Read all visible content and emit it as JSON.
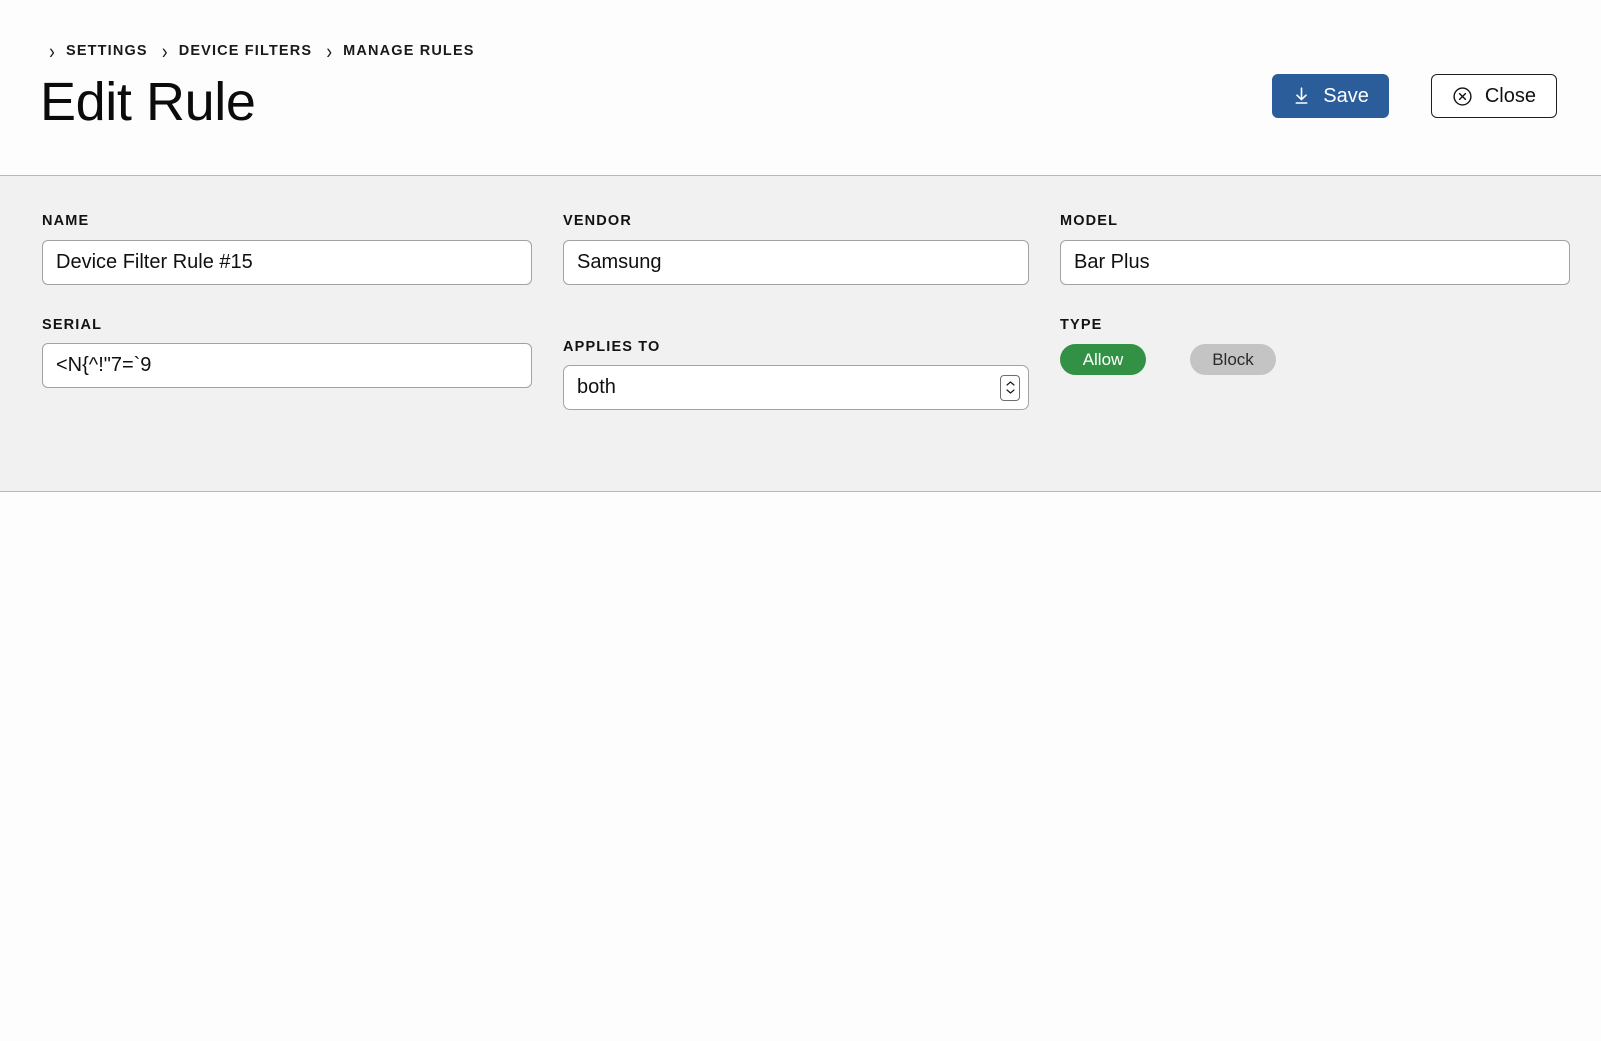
{
  "header": {
    "breadcrumb": {
      "separator": "›",
      "items": [
        {
          "label": "SETTINGS"
        },
        {
          "label": "DEVICE FILTERS"
        },
        {
          "label": "MANAGE RULES"
        }
      ]
    },
    "title": "Edit Rule",
    "actions": {
      "save": {
        "label": "Save",
        "icon": "save-download-icon",
        "color": "#2c5d9b",
        "text_color": "#ffffff"
      },
      "close": {
        "label": "Close",
        "icon": "close-circle-icon",
        "color": "#ffffff",
        "text_color": "#111111"
      }
    }
  },
  "form": {
    "name": {
      "label": "NAME",
      "value": "Device Filter Rule #15",
      "placeholder": ""
    },
    "serial": {
      "label": "SERIAL",
      "value": "<N{^!\"7=`9",
      "placeholder": ""
    },
    "vendor": {
      "label": "VENDOR",
      "value": "Samsung",
      "placeholder": ""
    },
    "applies_to": {
      "label": "APPLIES TO",
      "value": "both",
      "options": [
        "both"
      ]
    },
    "model": {
      "label": "MODEL",
      "value": "Bar Plus",
      "placeholder": ""
    },
    "type": {
      "label": "TYPE",
      "selected": "Allow",
      "options": [
        {
          "label": "Allow",
          "selected": true,
          "color": "#339145"
        },
        {
          "label": "Block",
          "selected": false,
          "color": "#c4c4c4"
        }
      ]
    }
  }
}
